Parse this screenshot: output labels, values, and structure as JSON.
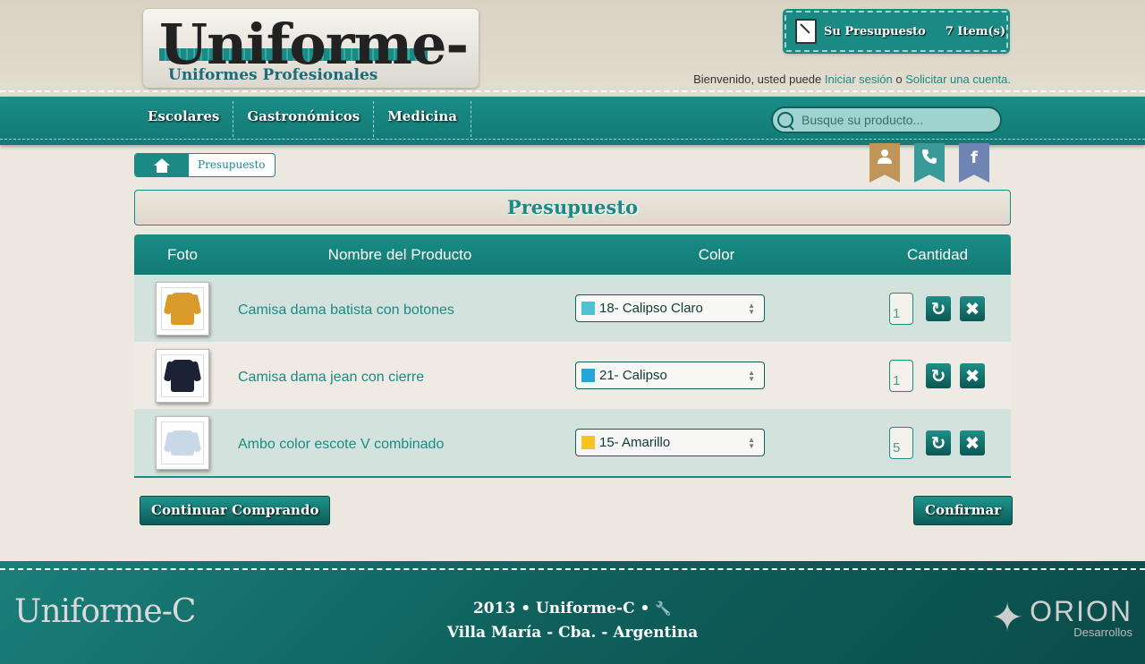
{
  "header": {
    "logo_title": "Uniforme-C",
    "logo_subtitle": "Uniformes Profesionales",
    "cart": {
      "label": "Su Presupuesto",
      "count": "7 Item(s)"
    },
    "welcome": {
      "prefix": "Bienvenido, usted puede ",
      "login_link": "Iniciar sesión",
      "middle": " o ",
      "signup_link": "Solicitar una cuenta."
    }
  },
  "nav": {
    "items": [
      {
        "label": "Escolares"
      },
      {
        "label": "Gastronómicos"
      },
      {
        "label": "Medicina"
      }
    ],
    "search_placeholder": "Busque su producto..."
  },
  "social": {
    "icons": [
      "user-icon",
      "phone-icon",
      "facebook-icon"
    ],
    "facebook_glyph": "f"
  },
  "breadcrumb": {
    "current": "Presupuesto"
  },
  "page": {
    "title": "Presupuesto"
  },
  "table": {
    "headers": [
      "Foto",
      "Nombre del Producto",
      "Color",
      "Cantidad"
    ],
    "rows": [
      {
        "name": "Camisa dama batista con botones",
        "color": "18- Calipso Claro",
        "swatch": "#4ec3d0",
        "qty": "1"
      },
      {
        "name": "Camisa dama jean con cierre",
        "color": "21- Calipso",
        "swatch": "#24a7d8",
        "qty": "1"
      },
      {
        "name": "Ambo color escote V combinado",
        "color": "15- Amarillo",
        "swatch": "#f5c325",
        "qty": "5"
      }
    ]
  },
  "actions": {
    "continue_label": "Continuar Comprando",
    "confirm_label": "Confirmar"
  },
  "footer": {
    "logo": "Uniforme-C",
    "line1": "2013 • Uniforme-C •",
    "line2": "Villa María - Cba. - Argentina",
    "brand_name": "ORION",
    "brand_sub": "Desarrollos"
  },
  "colors": {
    "accent": "#1b8a85",
    "accent_dark": "#0f5f5b",
    "row_alt": "#d4e2dd"
  }
}
